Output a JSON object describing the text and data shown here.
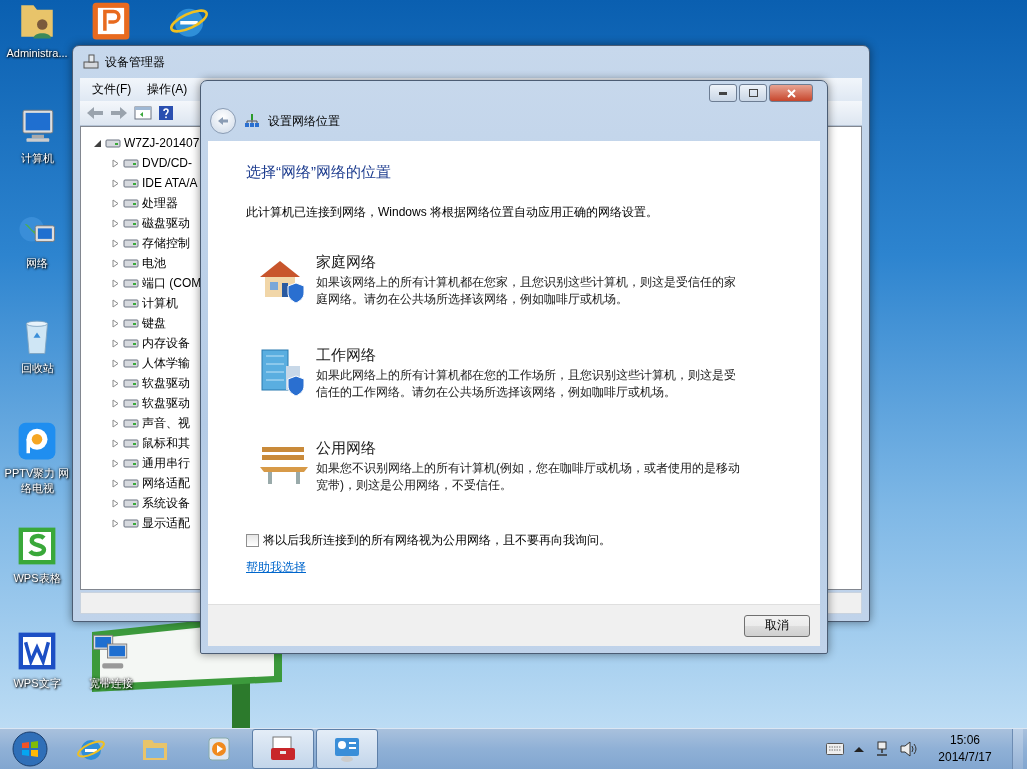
{
  "desktop": {
    "icons": [
      {
        "kind": "user-folder",
        "label": "Administra..."
      },
      {
        "kind": "orange-app"
      },
      {
        "kind": "browser"
      },
      {
        "kind": "computer",
        "label": "计算机"
      },
      {
        "kind": "network",
        "label": "网络"
      },
      {
        "kind": "recycle-bin",
        "label": "回收站"
      },
      {
        "kind": "video-player",
        "label": "PPTV聚力 网络电视"
      },
      {
        "kind": "spreadsheet",
        "label": "WPS表格"
      },
      {
        "kind": "writer",
        "label": "WPS文字"
      },
      {
        "kind": "broadband",
        "label": "宽带连接"
      }
    ]
  },
  "device_manager": {
    "title": "设备管理器",
    "menu": [
      "文件(F)",
      "操作(A)"
    ],
    "tree": {
      "label": "W7ZJ-201407",
      "expanded": true,
      "children": [
        {
          "label": "DVD/CD-",
          "expanded": false
        },
        {
          "label": "IDE ATA/A",
          "expanded": false
        },
        {
          "label": "处理器",
          "expanded": false
        },
        {
          "label": "磁盘驱动",
          "expanded": false
        },
        {
          "label": "存储控制",
          "expanded": false
        },
        {
          "label": "电池",
          "expanded": false
        },
        {
          "label": "端口 (COM",
          "expanded": false
        },
        {
          "label": "计算机",
          "expanded": false
        },
        {
          "label": "键盘",
          "expanded": false
        },
        {
          "label": "内存设备",
          "expanded": false
        },
        {
          "label": "人体学输",
          "expanded": false
        },
        {
          "label": "软盘驱动",
          "expanded": false
        },
        {
          "label": "软盘驱动",
          "expanded": false
        },
        {
          "label": "声音、视",
          "expanded": false
        },
        {
          "label": "鼠标和其",
          "expanded": false
        },
        {
          "label": "通用串行",
          "expanded": false
        },
        {
          "label": "网络适配",
          "expanded": false
        },
        {
          "label": "系统设备",
          "expanded": false
        },
        {
          "label": "显示适配",
          "expanded": false
        }
      ]
    }
  },
  "dialog": {
    "title": "设置网络位置",
    "heading": "选择“网络”网络的位置",
    "intro": "此计算机已连接到网络，Windows 将根据网络位置自动应用正确的网络设置。",
    "locations": [
      {
        "kind": "home",
        "title": "家庭网络",
        "description": "如果该网络上的所有计算机都在您家，且您识别这些计算机，则这是受信任的家庭网络。请勿在公共场所选择该网络，例如咖啡厅或机场。"
      },
      {
        "kind": "work",
        "title": "工作网络",
        "description": "如果此网络上的所有计算机都在您的工作场所，且您识别这些计算机，则这是受信任的工作网络。请勿在公共场所选择该网络，例如咖啡厅或机场。"
      },
      {
        "kind": "public",
        "title": "公用网络",
        "description": "如果您不识别网络上的所有计算机(例如，您在咖啡厅或机场，或者使用的是移动宽带)，则这是公用网络，不受信任。"
      }
    ],
    "checkbox": {
      "label": "将以后我所连接到的所有网络视为公用网络，且不要再向我询问。",
      "checked": false
    },
    "help_link": "帮助我选择",
    "cancel_button": "取消"
  },
  "taskbar": {
    "items": [
      {
        "kind": "browser",
        "open": false
      },
      {
        "kind": "folder",
        "open": false
      },
      {
        "kind": "media-player",
        "open": false
      },
      {
        "kind": "toolbox",
        "open": true
      },
      {
        "kind": "control-panel",
        "open": true
      }
    ],
    "clock": {
      "time": "15:06",
      "date": "2014/7/17"
    }
  }
}
